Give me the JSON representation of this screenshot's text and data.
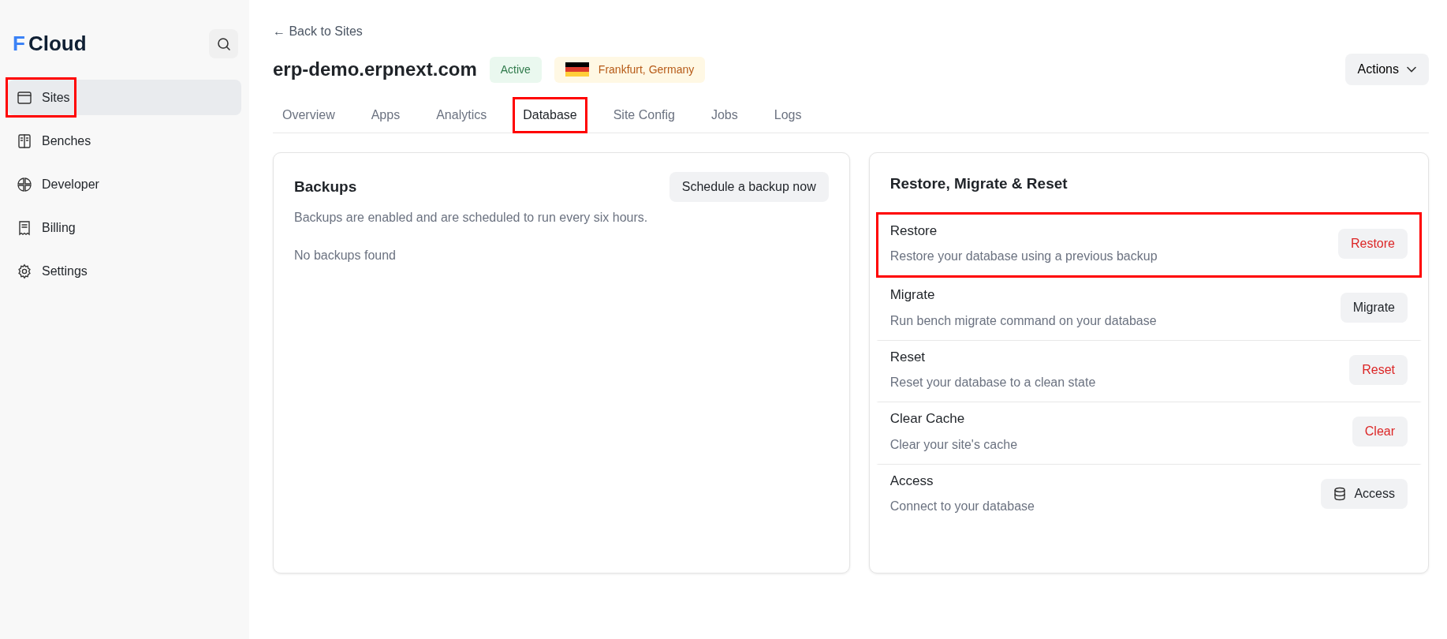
{
  "sidebar": {
    "logo_mark": "F",
    "logo_text": "Cloud",
    "items": [
      {
        "label": "Sites",
        "selected": true,
        "highlighted": true
      },
      {
        "label": "Benches",
        "selected": false,
        "highlighted": false
      },
      {
        "label": "Developer",
        "selected": false,
        "highlighted": false
      },
      {
        "label": "Billing",
        "selected": false,
        "highlighted": false
      },
      {
        "label": "Settings",
        "selected": false,
        "highlighted": false
      }
    ]
  },
  "header": {
    "back_link": "← Back to Sites",
    "site_name": "erp-demo.erpnext.com",
    "status": "Active",
    "region": "Frankfurt, Germany",
    "actions_button": "Actions"
  },
  "tabs": [
    {
      "label": "Overview",
      "selected": false,
      "highlighted": false
    },
    {
      "label": "Apps",
      "selected": false,
      "highlighted": false
    },
    {
      "label": "Analytics",
      "selected": false,
      "highlighted": false
    },
    {
      "label": "Database",
      "selected": true,
      "highlighted": true
    },
    {
      "label": "Site Config",
      "selected": false,
      "highlighted": false
    },
    {
      "label": "Jobs",
      "selected": false,
      "highlighted": false
    },
    {
      "label": "Logs",
      "selected": false,
      "highlighted": false
    }
  ],
  "backups": {
    "title": "Backups",
    "button": "Schedule a backup now",
    "description": "Backups are enabled and are scheduled to run every six hours.",
    "empty_message": "No backups found"
  },
  "database_actions": {
    "title": "Restore, Migrate & Reset",
    "rows": [
      {
        "title": "Restore",
        "description": "Restore your database using a previous backup",
        "button": "Restore",
        "kind": "danger",
        "highlighted": true
      },
      {
        "title": "Migrate",
        "description": "Run bench migrate command on your database",
        "button": "Migrate",
        "kind": "neutral",
        "highlighted": false
      },
      {
        "title": "Reset",
        "description": "Reset your database to a clean state",
        "button": "Reset",
        "kind": "danger",
        "highlighted": false
      },
      {
        "title": "Clear Cache",
        "description": "Clear your site's cache",
        "button": "Clear",
        "kind": "danger",
        "highlighted": false
      },
      {
        "title": "Access",
        "description": "Connect to your database",
        "button": "Access",
        "kind": "database",
        "highlighted": false
      }
    ]
  }
}
